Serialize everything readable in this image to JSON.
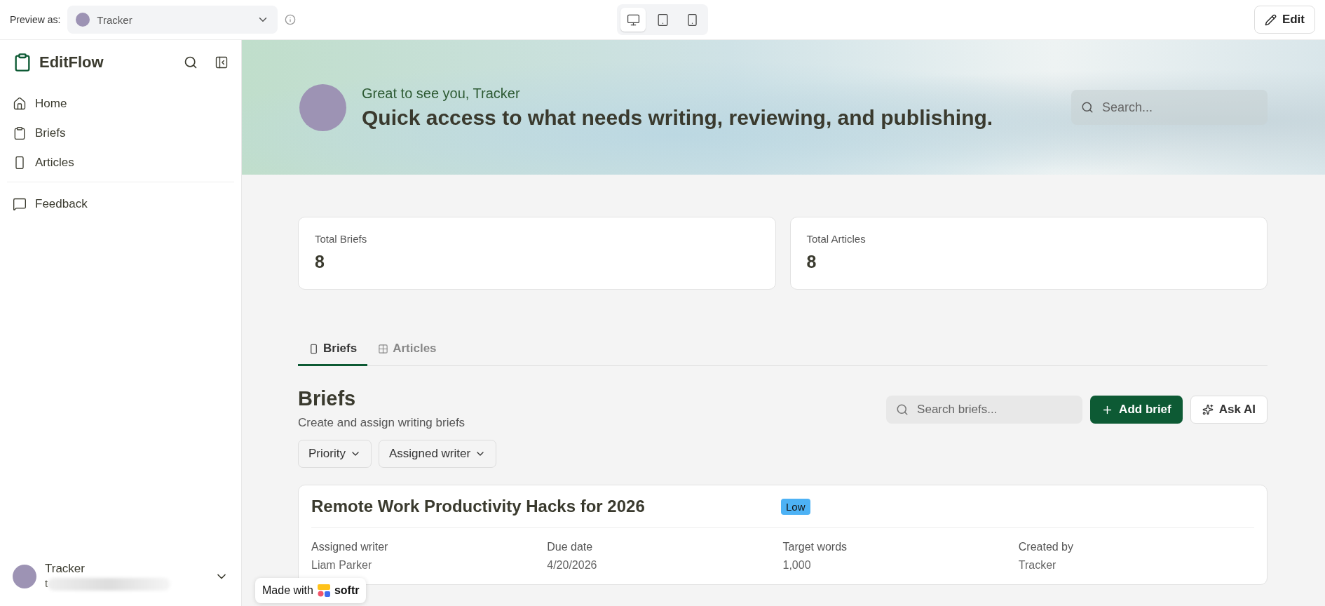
{
  "preview": {
    "label": "Preview as:",
    "user": "Tracker",
    "devices": [
      {
        "kind": "desktop",
        "selected": true
      },
      {
        "kind": "tablet",
        "selected": false
      },
      {
        "kind": "phone",
        "selected": false
      }
    ],
    "edit_button": "Edit"
  },
  "sidebar": {
    "app_name": "EditFlow",
    "items": [
      {
        "label": "Home",
        "kind": "home"
      },
      {
        "label": "Briefs",
        "kind": "clipboard"
      },
      {
        "label": "Articles",
        "kind": "page"
      }
    ],
    "secondary_items": [
      {
        "label": "Feedback",
        "kind": "chat"
      }
    ],
    "user": {
      "name": "Tracker",
      "email": "t"
    }
  },
  "banner": {
    "greeting": "Great to see you, Tracker",
    "headline": "Quick access to what needs writing, reviewing, and publishing.",
    "search_placeholder": "Search..."
  },
  "stats": [
    {
      "label": "Total Briefs",
      "value": "8"
    },
    {
      "label": "Total Articles",
      "value": "8"
    }
  ],
  "tabs": [
    {
      "label": "Briefs",
      "kind": "page",
      "selected": true
    },
    {
      "label": "Articles",
      "kind": "grid",
      "selected": false
    }
  ],
  "section": {
    "title": "Briefs",
    "subtitle": "Create and assign writing briefs",
    "search_placeholder": "Search briefs...",
    "add_button": "Add brief",
    "ai_button": "Ask AI",
    "filters": [
      "Priority",
      "Assigned writer"
    ]
  },
  "briefs": [
    {
      "title": "Remote Work Productivity Hacks for 2026",
      "priority": "Low",
      "color": "#4db2f5",
      "fields": [
        {
          "label": "Assigned writer",
          "value": "Liam Parker"
        },
        {
          "label": "Due date",
          "value": "4/20/2026"
        },
        {
          "label": "Target words",
          "value": "1,000"
        },
        {
          "label": "Created by",
          "value": "Tracker"
        }
      ]
    }
  ],
  "badge": {
    "prefix": "Made with",
    "brand": "softr"
  }
}
